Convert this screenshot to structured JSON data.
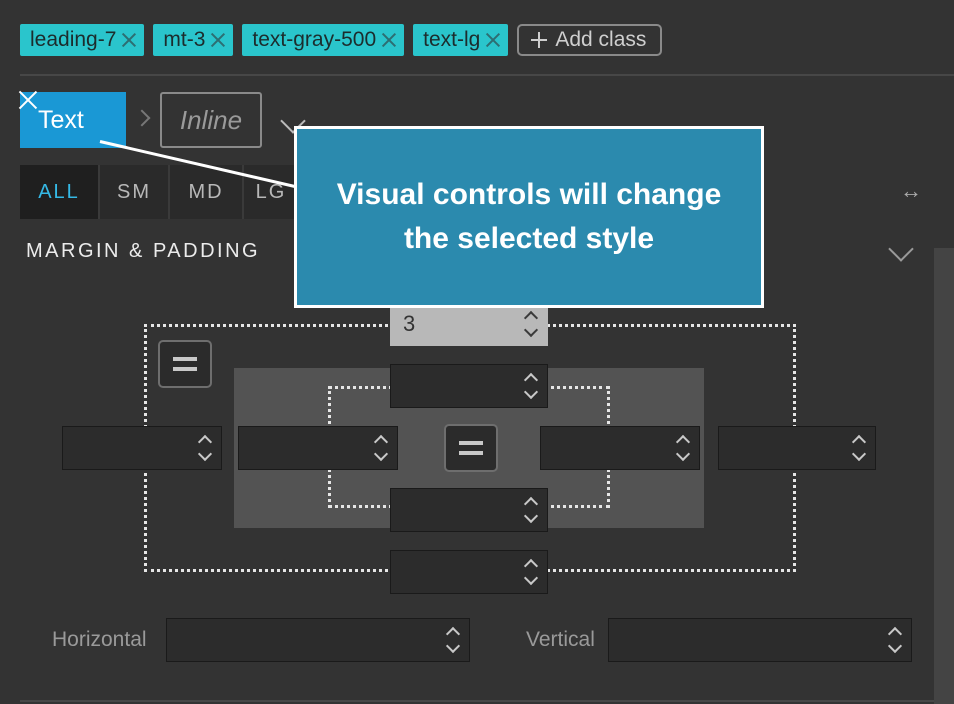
{
  "classes": {
    "chips": [
      "leading-7",
      "mt-3",
      "text-gray-500",
      "text-lg"
    ],
    "add_label": "Add class"
  },
  "selector": {
    "element_label": "Text",
    "state_placeholder": "Inline"
  },
  "breakpoints": {
    "items": [
      "ALL",
      "SM",
      "MD",
      "LG"
    ],
    "active": "ALL"
  },
  "section": {
    "title": "MARGIN & PADDING"
  },
  "box_model": {
    "margin_top": "3",
    "margin_right": "",
    "margin_bottom": "",
    "margin_left": "",
    "padding_top": "",
    "padding_right": "",
    "padding_bottom": "",
    "padding_left": ""
  },
  "axis_inputs": {
    "horizontal_label": "Horizontal",
    "horizontal_value": "",
    "vertical_label": "Vertical",
    "vertical_value": ""
  },
  "tooltip": {
    "text": "Visual controls will change the selected style"
  },
  "colors": {
    "chip_bg": "#2ac5cc",
    "selected_element_bg": "#1a98d5",
    "active_breakpoint": "#35b9e6",
    "tooltip_bg": "#2b8aae"
  }
}
